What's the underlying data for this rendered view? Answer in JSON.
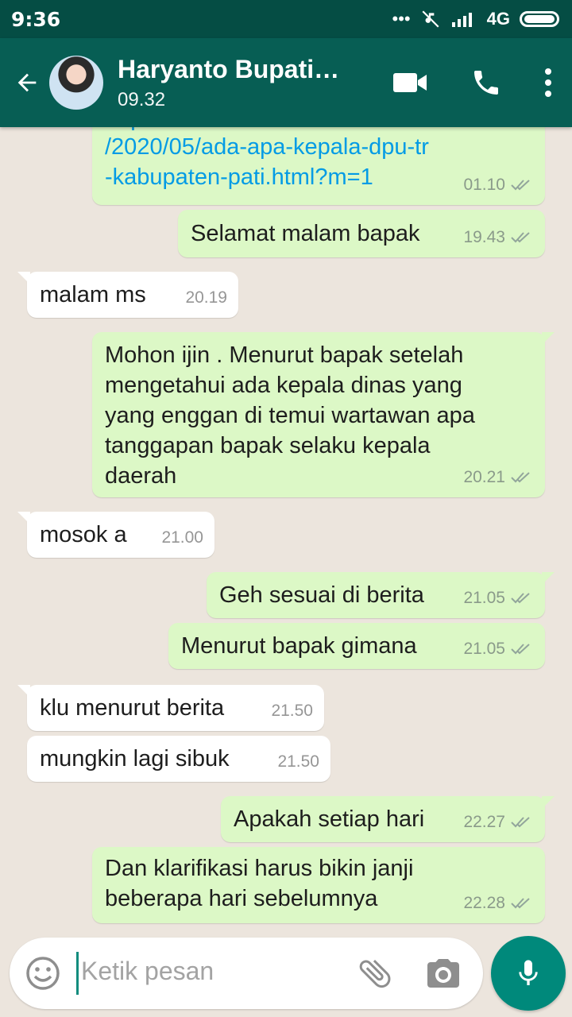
{
  "status_bar": {
    "time": "9:36",
    "network": "4G"
  },
  "header": {
    "contact_name": "Haryanto Bupati…",
    "last_seen": "09.32"
  },
  "messages": [
    {
      "direction": "out",
      "text": "/2020/05/ada-apa-kepala-dpu-tr\n-kabupaten-pati.html?m=1",
      "time": "01.10",
      "read": true,
      "link": true
    },
    {
      "direction": "out",
      "text": "Selamat malam bapak",
      "time": "19.43",
      "read": true
    },
    {
      "direction": "in",
      "text": "malam ms",
      "time": "20.19"
    },
    {
      "direction": "out",
      "text": "Mohon ijin . Menurut bapak setelah mengetahui ada kepala dinas yang yang enggan di temui wartawan apa tanggapan bapak selaku kepala daerah",
      "time": "20.21",
      "read": true
    },
    {
      "direction": "in",
      "text": "mosok a",
      "time": "21.00"
    },
    {
      "direction": "out",
      "text": "Geh sesuai di berita",
      "time": "21.05",
      "read": true
    },
    {
      "direction": "out",
      "text": "Menurut bapak gimana",
      "time": "21.05",
      "read": true
    },
    {
      "direction": "in",
      "text": "klu menurut berita",
      "time": "21.50"
    },
    {
      "direction": "in",
      "text": "mungkin lagi sibuk",
      "time": "21.50"
    },
    {
      "direction": "out",
      "text": "Apakah setiap hari",
      "time": "22.27",
      "read": true
    },
    {
      "direction": "out",
      "text": "Dan klarifikasi harus bikin janji beberapa hari sebelumnya",
      "time": "22.28",
      "read": true
    }
  ],
  "input": {
    "placeholder": "Ketik pesan"
  },
  "colors": {
    "header": "#075e54",
    "status_bar": "#054d44",
    "outgoing_bubble": "#dcf8c6",
    "incoming_bubble": "#ffffff",
    "link": "#039be5",
    "mic_button": "#00897b"
  },
  "icons": [
    "back-arrow-icon",
    "video-call-icon",
    "phone-icon",
    "more-vert-icon",
    "emoji-icon",
    "attach-icon",
    "camera-icon",
    "mic-icon",
    "double-check-icon"
  ]
}
